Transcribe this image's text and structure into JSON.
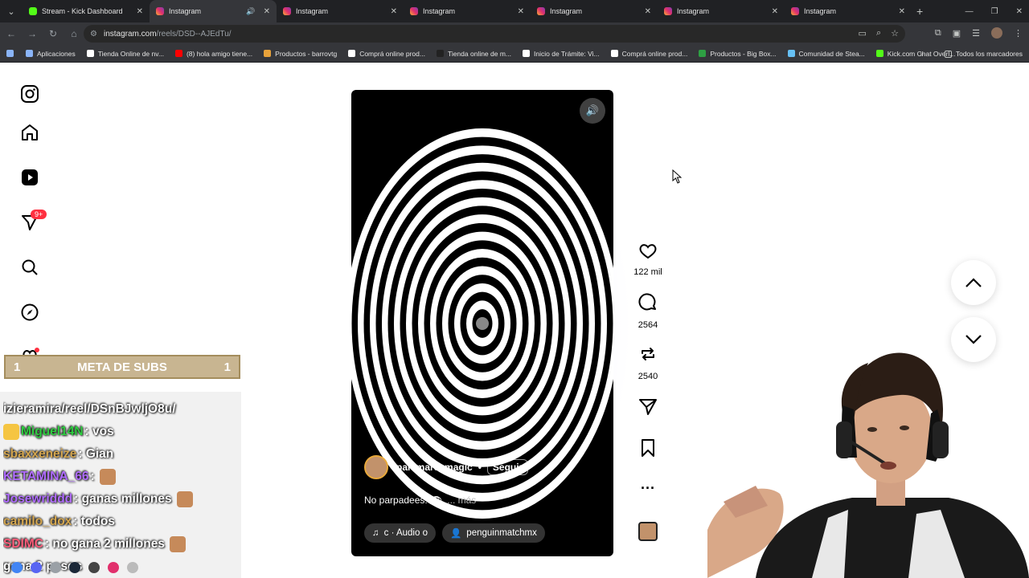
{
  "browser": {
    "tabs": [
      {
        "title": "Stream - Kick Dashboard",
        "favicon": "kick"
      },
      {
        "title": "Instagram",
        "favicon": "instagram",
        "active": true,
        "audio": true
      },
      {
        "title": "Instagram",
        "favicon": "instagram"
      },
      {
        "title": "Instagram",
        "favicon": "instagram"
      },
      {
        "title": "Instagram",
        "favicon": "instagram"
      },
      {
        "title": "Instagram",
        "favicon": "instagram"
      },
      {
        "title": "Instagram",
        "favicon": "instagram"
      }
    ],
    "url_host": "instagram.com",
    "url_path": "/reels/DSD--AJEdTu/",
    "bookmarks": [
      {
        "label": "Aplicaciones",
        "color": "#8ab4f8"
      },
      {
        "label": "Tienda Online de nv...",
        "color": "#ffffff"
      },
      {
        "label": "(8) hola amigo tiene...",
        "color": "#ff0000"
      },
      {
        "label": "Productos - barrovtg",
        "color": "#e8a23a"
      },
      {
        "label": "Comprá online prod...",
        "color": "#ffffff"
      },
      {
        "label": "Tienda online de m...",
        "color": "#222222"
      },
      {
        "label": "Inicio de Trámite: Vi...",
        "color": "#ffffff"
      },
      {
        "label": "Comprá online prod...",
        "color": "#ffffff"
      },
      {
        "label": "Productos - Big Box...",
        "color": "#2ea043"
      },
      {
        "label": "Comunidad de Stea...",
        "color": "#66c0f4"
      },
      {
        "label": "Kick.com Chat Overl...",
        "color": "#53fc18"
      }
    ],
    "bookmarks_all": "Todos los marcadores"
  },
  "sidebar": {
    "notifications_badge": "9+"
  },
  "reel": {
    "author": "palomaresmagic",
    "follow_label": "Seguir",
    "separator": "•",
    "caption": "No parpadees! 👁",
    "more_label": "... más",
    "audio_label": "c · Audio o",
    "tagged_user": "penguinmatchmx"
  },
  "actions": {
    "likes": "122 mil",
    "comments": "2564",
    "reposts": "2540"
  },
  "overlay": {
    "subs_left": "1",
    "subs_title": "META DE SUBS",
    "subs_right": "1",
    "chat": [
      {
        "name": "",
        "color": "#ffffff",
        "text": "izieramira/reel/DSnBJwljO8u/"
      },
      {
        "name": "Miguel14N",
        "color": "#2ecc40",
        "text": ": vos"
      },
      {
        "name": "sbaxxeneize",
        "color": "#d4a64f",
        "text": ": Gian"
      },
      {
        "name": "KETAMINA_66",
        "color": "#b06cff",
        "text": ":"
      },
      {
        "name": "Josewriddd",
        "color": "#b06cff",
        "text": ": ganas millones"
      },
      {
        "name": "camilo_dox",
        "color": "#d4a64f",
        "text": ": todos"
      },
      {
        "name": "SDIMC",
        "color": "#ff5c7a",
        "text": ": no gana 2 millones"
      },
      {
        "name": "",
        "color": "#ffffff",
        "text": "gana 2 pesos"
      }
    ]
  },
  "colors": {
    "accent_notification": "#ff3040",
    "subs_bar": "#c8b591"
  }
}
